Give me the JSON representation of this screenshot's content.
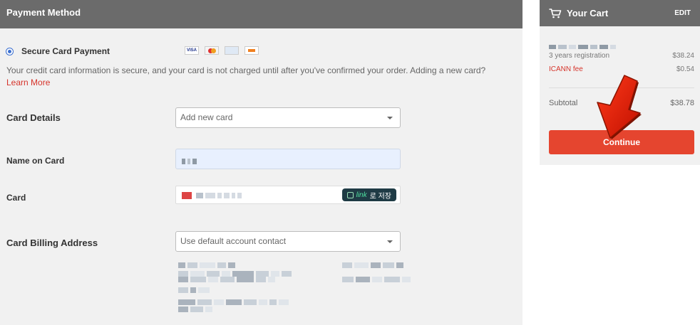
{
  "payment": {
    "header_title": "Payment Method",
    "secure_label": "Secure Card Payment",
    "card_logos": [
      "VISA",
      "mastercard",
      "amex",
      "discover"
    ],
    "secure_text": "Your credit card information is secure, and your card is not charged until after you've confirmed your order. Adding a new card?",
    "learn_more": "Learn More",
    "card_details_label": "Card Details",
    "card_details_select": "Add new card",
    "name_label": "Name on Card",
    "card_label": "Card",
    "link_badge_brand": "link",
    "link_badge_text": "로 저장",
    "billing_label": "Card Billing Address",
    "billing_select": "Use default account contact"
  },
  "cart": {
    "title": "Your Cart",
    "edit": "EDIT",
    "items": [
      {
        "label": "3 years registration",
        "price": "$38.24"
      },
      {
        "label": "ICANN fee",
        "price": "$0.54"
      }
    ],
    "subtotal_label": "Subtotal",
    "subtotal_value": "$38.78",
    "continue_label": "Continue"
  },
  "colors": {
    "header_bg": "#6b6b6b",
    "accent_red": "#e5452f",
    "link_red": "#d6342b",
    "panel_bg": "#f1f1f1"
  },
  "icons": [
    "cart-icon",
    "radio-selected-icon",
    "dropdown-caret-icon",
    "link-save-icon",
    "red-arrow-icon"
  ]
}
